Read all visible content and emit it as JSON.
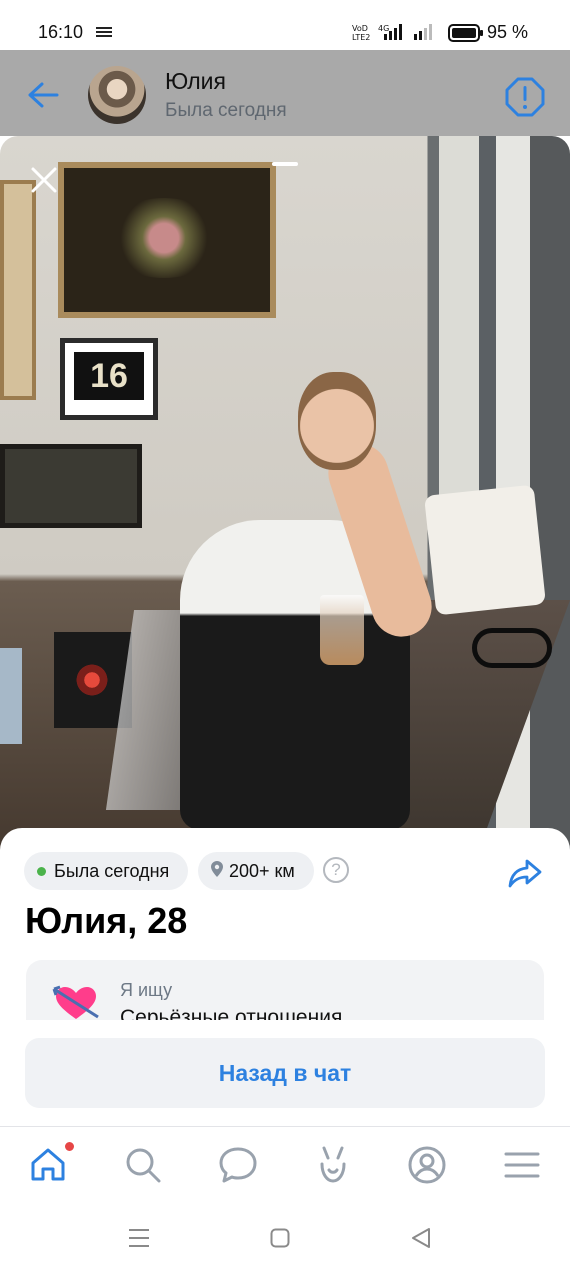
{
  "status_bar": {
    "time": "16:10",
    "battery": "95 %"
  },
  "header": {
    "name": "Юлия",
    "status": "Была сегодня"
  },
  "profile": {
    "chips": {
      "online": "Была сегодня",
      "distance": "200+ км"
    },
    "name_age": "Юлия, 28",
    "looking_for": {
      "label": "Я ищу",
      "value": "Серьёзные отношения"
    },
    "chat_button": "Назад в чат"
  },
  "colors": {
    "accent": "#2d81e0",
    "online": "#4bb34b",
    "notification": "#e64646"
  },
  "icons": {
    "back": "arrow-left-icon",
    "alert": "alert-circle-icon",
    "close": "close-icon",
    "location": "location-pin-icon",
    "help": "question-icon",
    "share": "share-icon",
    "heart": "heart-arrow-icon",
    "tabs": [
      "home-icon",
      "search-icon",
      "messages-icon",
      "clips-icon",
      "profile-icon",
      "menu-icon"
    ],
    "nav": [
      "recent-apps-icon",
      "home-square-icon",
      "back-triangle-icon"
    ]
  }
}
